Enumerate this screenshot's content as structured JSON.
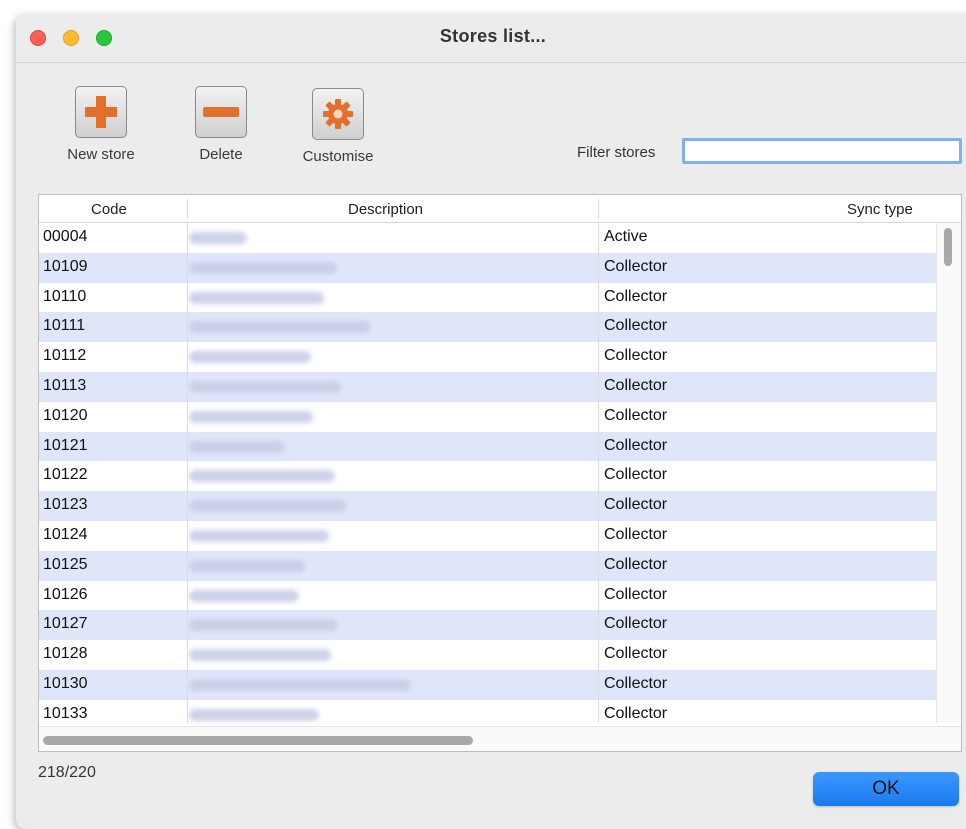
{
  "window": {
    "title": "Stores list..."
  },
  "toolbar": {
    "new_store_label": "New store",
    "delete_label": "Delete",
    "customise_label": "Customise"
  },
  "filter": {
    "label": "Filter stores",
    "value": ""
  },
  "table": {
    "headers": {
      "code": "Code",
      "description": "Description",
      "sync_type": "Sync type"
    },
    "rows": [
      {
        "code": "00004",
        "sync_type": "Active"
      },
      {
        "code": "10109",
        "sync_type": "Collector"
      },
      {
        "code": "10110",
        "sync_type": "Collector"
      },
      {
        "code": "10111",
        "sync_type": "Collector"
      },
      {
        "code": "10112",
        "sync_type": "Collector"
      },
      {
        "code": "10113",
        "sync_type": "Collector"
      },
      {
        "code": "10120",
        "sync_type": "Collector"
      },
      {
        "code": "10121",
        "sync_type": "Collector"
      },
      {
        "code": "10122",
        "sync_type": "Collector"
      },
      {
        "code": "10123",
        "sync_type": "Collector"
      },
      {
        "code": "10124",
        "sync_type": "Collector"
      },
      {
        "code": "10125",
        "sync_type": "Collector"
      },
      {
        "code": "10126",
        "sync_type": "Collector"
      },
      {
        "code": "10127",
        "sync_type": "Collector"
      },
      {
        "code": "10128",
        "sync_type": "Collector"
      },
      {
        "code": "10130",
        "sync_type": "Collector"
      },
      {
        "code": "10133",
        "sync_type": "Collector"
      }
    ]
  },
  "footer": {
    "count": "218/220",
    "ok_label": "OK"
  },
  "colors": {
    "accent": "#1a7bf0",
    "row_alt": "#dfe6fa",
    "icon_orange": "#e36f2b"
  },
  "icons": [
    "plus-icon",
    "minus-icon",
    "gear-icon"
  ]
}
